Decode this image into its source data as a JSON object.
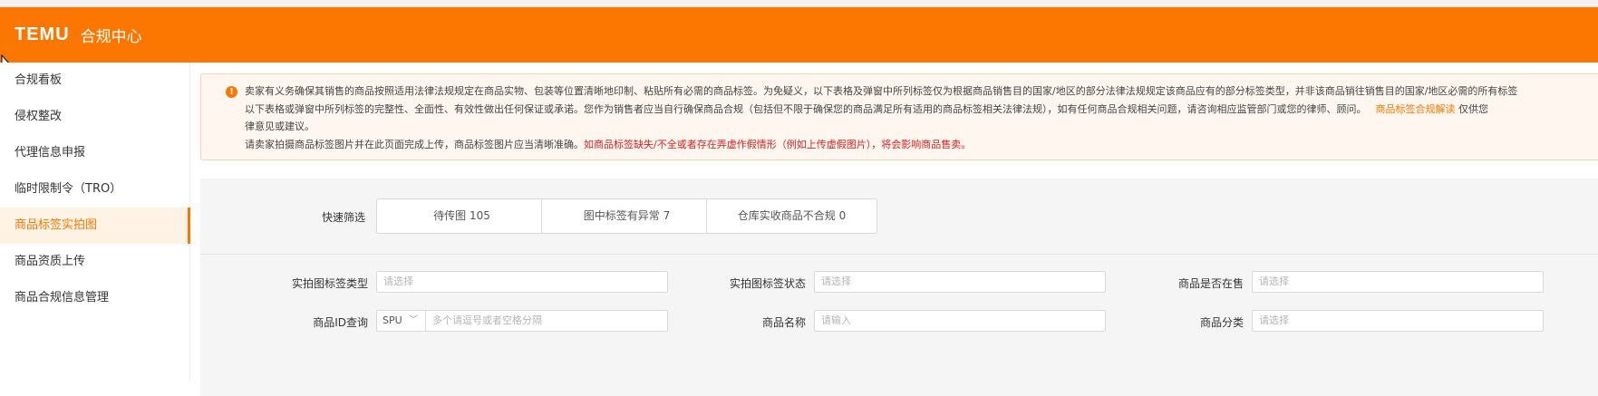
{
  "header": {
    "logo": "TEMU",
    "title": "合规中心"
  },
  "sidebar": {
    "items": [
      {
        "label": "合规看板",
        "active": false
      },
      {
        "label": "侵权整改",
        "active": false
      },
      {
        "label": "代理信息申报",
        "active": false
      },
      {
        "label": "临时限制令（TRO）",
        "active": false
      },
      {
        "label": "商品标签实拍图",
        "active": true
      },
      {
        "label": "商品资质上传",
        "active": false
      },
      {
        "label": "商品合规信息管理",
        "active": false
      }
    ]
  },
  "notice": {
    "line1": "卖家有义务确保其销售的商品按照适用法律法规规定在商品实物、包装等位置清晰地印制、粘贴所有必需的商品标签。为免疑义，以下表格及弹窗中所列标签仅为根据商品销售目的国家/地区的部分法律法规规定该商品应有的部分标签类型，并非该商品销往销售目的国家/地区必需的所有标签",
    "line2": "以下表格或弹窗中所列标签的完整性、全面性、有效性做出任何保证或承诺。您作为销售者应当自行确保商品合规（包括但不限于确保您的商品满足所有适用的商品标签相关法律法规），如有任何商品合规相关问题，请咨询相应监管部门或您的律师、顾问。",
    "link": "商品标签合规解读",
    "line2_tail": "仅供您",
    "line3": "律意见或建议。",
    "line4_pre": "请卖家拍摄商品标签图片并在此页面完成上传，商品标签图片应当清晰准确。",
    "line4_red": "如商品标签缺失/不全或者存在弄虚作假情形（例如上传虚假图片），将会影响商品售卖。"
  },
  "quick_filter": {
    "label": "快速筛选",
    "chips": [
      "待传图 105",
      "图中标签有异常 7",
      "仓库实收商品不合规 0"
    ]
  },
  "filters": {
    "label_type": {
      "label": "实拍图标签类型",
      "placeholder": "请选择"
    },
    "label_status": {
      "label": "实拍图标签状态",
      "placeholder": "请选择"
    },
    "on_sale": {
      "label": "商品是否在售",
      "placeholder": "请选择"
    },
    "id_query": {
      "label": "商品ID查询",
      "prefix": "SPU",
      "placeholder": "多个请逗号或者空格分隔"
    },
    "name": {
      "label": "商品名称",
      "placeholder": "请输入"
    },
    "category": {
      "label": "商品分类",
      "placeholder": "请选择"
    }
  },
  "colors": {
    "brand": "#fb7701",
    "warning_red": "#e02020"
  },
  "icons": [
    "warning-icon",
    "chevron-down-icon",
    "mouse-cursor-icon"
  ]
}
